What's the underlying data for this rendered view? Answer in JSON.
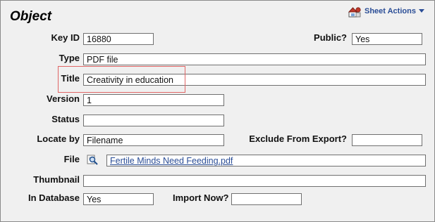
{
  "header": {
    "title": "Object",
    "sheet_actions_label": "Sheet Actions",
    "sheet_actions_icon": "sheet-actions-icon"
  },
  "fields": {
    "key_id": {
      "label": "Key ID",
      "value": "16880"
    },
    "public": {
      "label": "Public?",
      "value": "Yes"
    },
    "type": {
      "label": "Type",
      "value": "PDF file"
    },
    "title": {
      "label": "Title",
      "value": "Creativity in education"
    },
    "version": {
      "label": "Version",
      "value": "1"
    },
    "status": {
      "label": "Status",
      "value": ""
    },
    "locate_by": {
      "label": "Locate by",
      "value": "Filename"
    },
    "exclude_from_export": {
      "label": "Exclude From Export?",
      "value": ""
    },
    "file": {
      "label": "File",
      "value": "Fertile Minds Need Feeding.pdf",
      "icon": "magnifier-file-icon"
    },
    "thumbnail": {
      "label": "Thumbnail",
      "value": ""
    },
    "in_database": {
      "label": "In Database",
      "value": "Yes"
    },
    "import_now": {
      "label": "Import Now?",
      "value": ""
    }
  },
  "colors": {
    "link": "#2a4d96",
    "highlight": "#e06666",
    "background": "#f0f0f0"
  }
}
